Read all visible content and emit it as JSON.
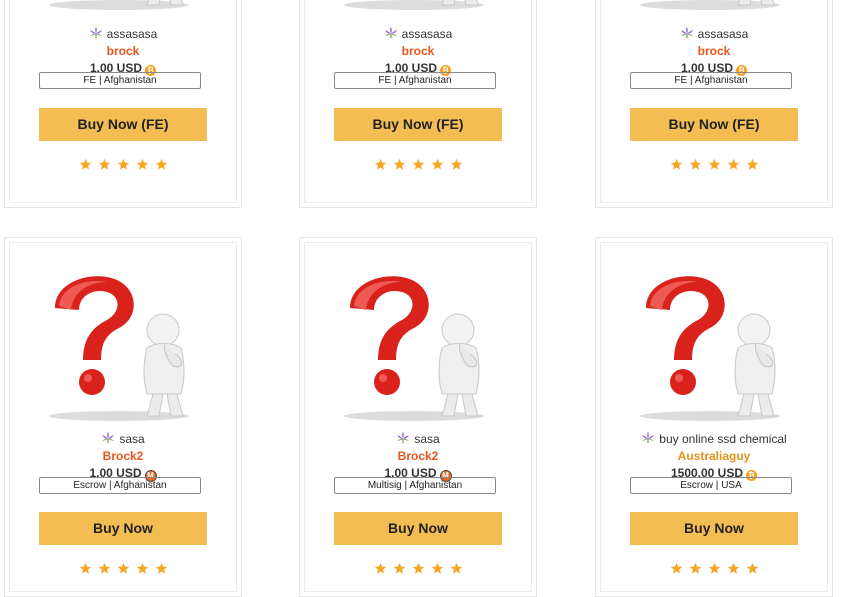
{
  "products": [
    {
      "vendor": "assasasa",
      "seller": "brock",
      "price": "1.00 USD",
      "coin": "bitcoin",
      "tag": "FE | Afghanistan",
      "button": "Buy Now  (FE)",
      "rating": 5
    },
    {
      "vendor": "assasasa",
      "seller": "brock",
      "price": "1.00 USD",
      "coin": "bitcoin",
      "tag": "FE | Afghanistan",
      "button": "Buy Now  (FE)",
      "rating": 5
    },
    {
      "vendor": "assasasa",
      "seller": "brock",
      "price": "1.00 USD",
      "coin": "bitcoin",
      "tag": "FE | Afghanistan",
      "button": "Buy Now  (FE)",
      "rating": 5
    },
    {
      "vendor": "sasa",
      "seller": "Brock2",
      "price": "1.00 USD",
      "coin": "monero",
      "tag": "Escrow | Afghanistan",
      "button": "Buy Now",
      "rating": 5
    },
    {
      "vendor": "sasa",
      "seller": "Brock2",
      "price": "1.00 USD",
      "coin": "monero",
      "tag": "Multisig | Afghanistan",
      "button": "Buy Now",
      "rating": 5
    },
    {
      "vendor": "buy online ssd chemical",
      "seller": "Australiaguy",
      "price": "1500.00 USD",
      "coin": "bitcoin",
      "tag": "Escrow | USA",
      "button": "Buy Now",
      "rating": 5
    }
  ],
  "colors": {
    "button_bg": "#f3bd53",
    "seller_red": "#e8561c",
    "seller_orange": "#e5931b",
    "star": "#f5a623",
    "bitcoin": "#f7a01c",
    "monero": "#f26822"
  },
  "icons": {
    "category": "cannabis-leaf-icon",
    "bitcoin": "bitcoin-icon",
    "monero": "monero-icon",
    "star": "star-icon",
    "placeholder": "question-mark-person-image"
  }
}
